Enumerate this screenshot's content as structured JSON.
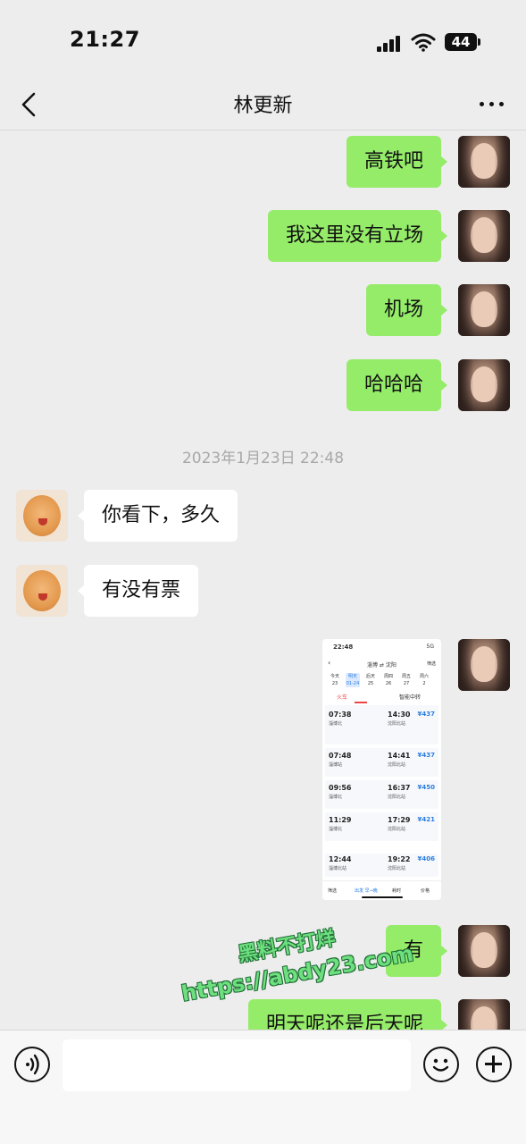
{
  "status_bar": {
    "time": "21:27",
    "battery": "44"
  },
  "nav": {
    "title": "林更新"
  },
  "messages": {
    "m1": "高铁吧",
    "m2": "我这里没有立场",
    "m3": "机场",
    "m4": "哈哈哈",
    "timestamp": "2023年1月23日 22:48",
    "m5": "你看下，多久",
    "m6": "有没有票",
    "m8": "有",
    "m9": "明天呢还是后天呢"
  },
  "screenshot": {
    "status_time": "22:48",
    "status_right": "5G",
    "route_from": "淄博",
    "route_to": "沈阳",
    "filter": "筛选",
    "days": [
      {
        "wd": "今天",
        "d": "23"
      },
      {
        "wd": "明天",
        "d": "01-24"
      },
      {
        "wd": "后天",
        "d": "25"
      },
      {
        "wd": "周四",
        "d": "26"
      },
      {
        "wd": "周五",
        "d": "27"
      },
      {
        "wd": "周六",
        "d": "2"
      }
    ],
    "tab_train": "火车",
    "tab_smart": "智能中转",
    "trains": [
      {
        "dep": "07:38",
        "arr": "14:30",
        "dep_stn": "淄博北",
        "arr_stn": "沈阳北站",
        "price": "¥437"
      },
      {
        "dep": "07:48",
        "arr": "14:41",
        "dep_stn": "淄博站",
        "arr_stn": "沈阳北站",
        "price": "¥437"
      },
      {
        "dep": "09:56",
        "arr": "16:37",
        "dep_stn": "淄博北",
        "arr_stn": "沈阳北站",
        "price": "¥450"
      },
      {
        "dep": "11:29",
        "arr": "17:29",
        "dep_stn": "淄博北",
        "arr_stn": "沈阳北站",
        "price": "¥421"
      },
      {
        "dep": "12:44",
        "arr": "19:22",
        "dep_stn": "淄博北站",
        "arr_stn": "沈阳北站",
        "price": "¥406"
      }
    ],
    "bottom_tabs": [
      "筛选",
      "出发 早→晚",
      "耗时",
      "价格"
    ]
  },
  "watermark": {
    "line1": "黑料不打烊",
    "line2": "https://abdy23.com"
  },
  "input": {
    "placeholder": ""
  },
  "colors": {
    "my_bubble": "#95ec69",
    "their_bubble": "#ffffff",
    "background": "#ededed"
  }
}
